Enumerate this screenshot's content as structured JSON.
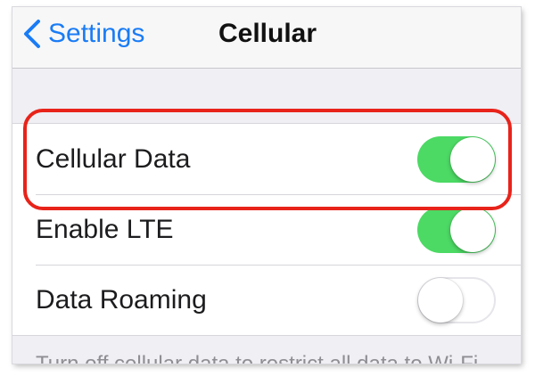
{
  "nav": {
    "back_label": "Settings",
    "title": "Cellular",
    "back_icon": "chevron-left-icon"
  },
  "rows": [
    {
      "label": "Cellular Data",
      "toggle": "on"
    },
    {
      "label": "Enable LTE",
      "toggle": "on"
    },
    {
      "label": "Data Roaming",
      "toggle": "off"
    }
  ],
  "footer_note": "Turn off cellular data to restrict all data to Wi-Fi",
  "colors": {
    "accent": "#1a7cf5",
    "toggle_on": "#4cd964",
    "highlight": "#e8231a",
    "background": "#efeff4"
  },
  "annotation": {
    "type": "highlight-rectangle",
    "target": "Cellular Data"
  }
}
